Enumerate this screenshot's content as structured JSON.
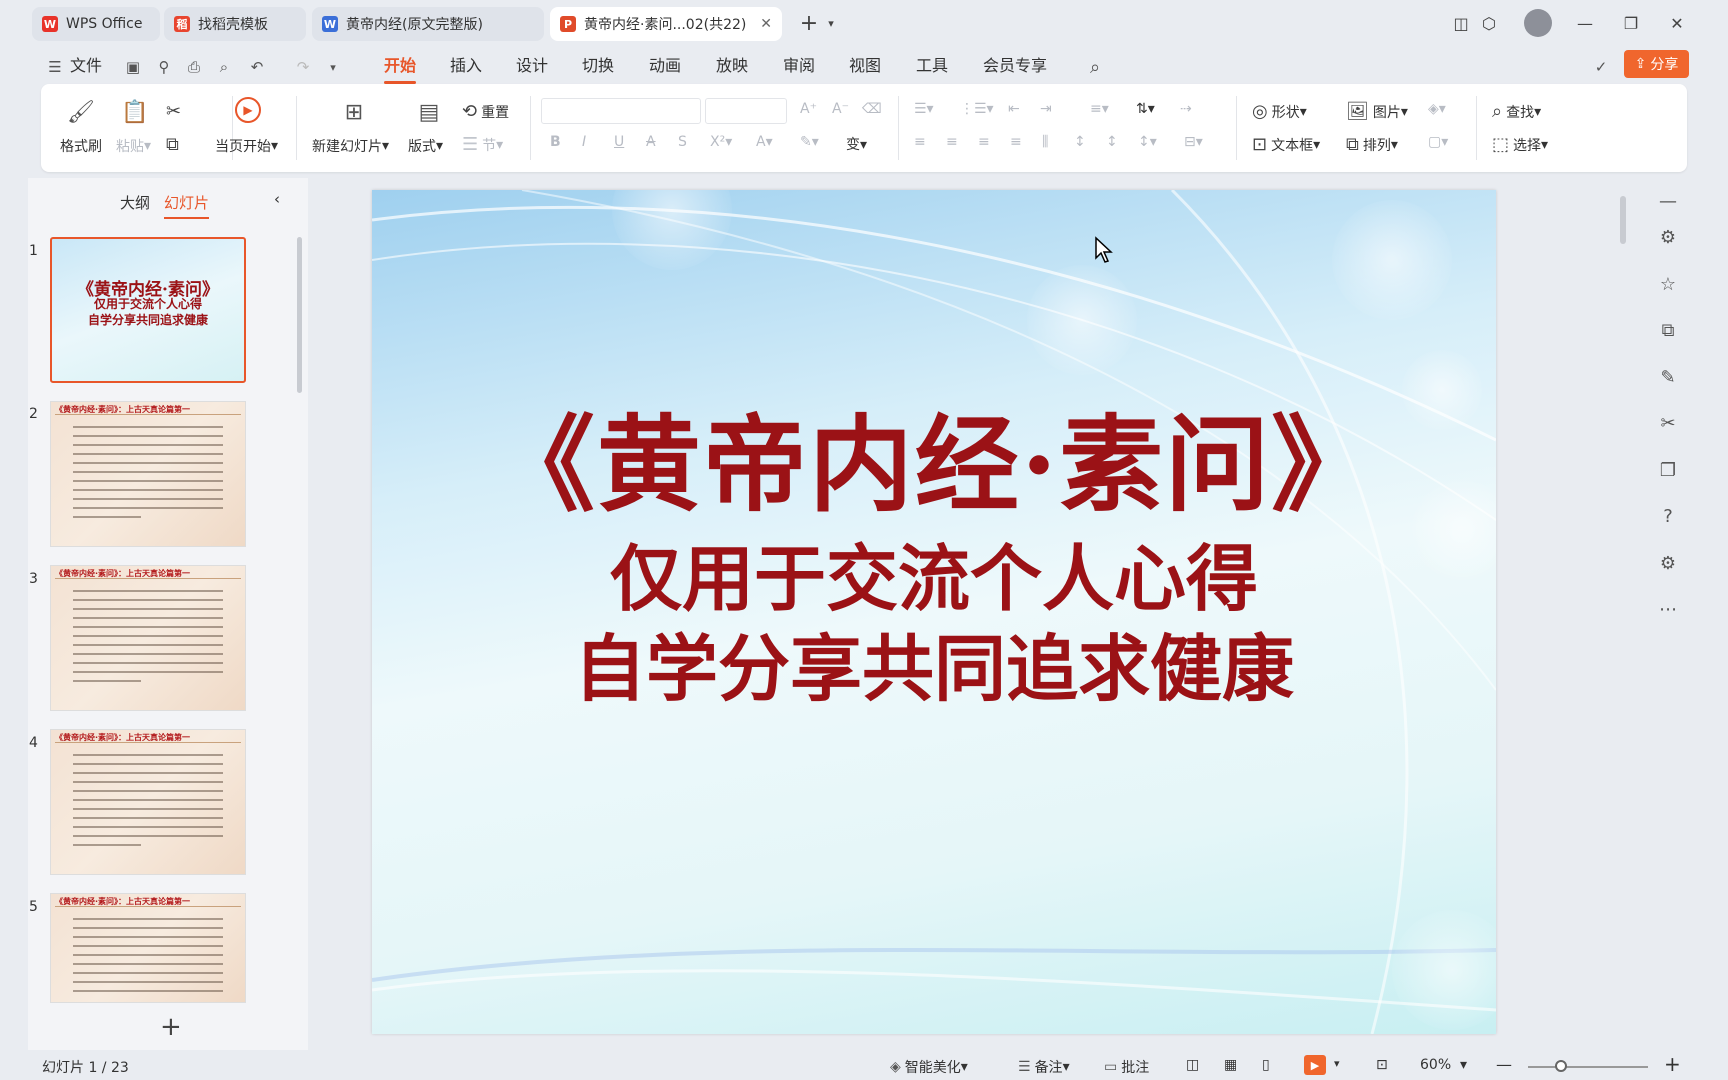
{
  "tabs": [
    {
      "label": "WPS Office",
      "icon": "wps-logo-icon",
      "color": "#e8332a"
    },
    {
      "label": "找稻壳模板",
      "icon": "docer-icon",
      "color": "#e8452f"
    },
    {
      "label": "黄帝内经(原文完整版)",
      "icon": "word-icon",
      "color": "#3b6fd8"
    },
    {
      "label": "黄帝内经·素问...02(共22)",
      "icon": "ppt-icon",
      "color": "#e04b2a"
    }
  ],
  "menu": {
    "file": "文件",
    "items": [
      "开始",
      "插入",
      "设计",
      "切换",
      "动画",
      "放映",
      "审阅",
      "视图",
      "工具",
      "会员专享"
    ],
    "active": "开始",
    "share": "分享"
  },
  "ribbon": {
    "format_painter": "格式刷",
    "paste": "粘贴",
    "from_current": "当页开始",
    "new_slide": "新建幻灯片",
    "layout": "版式",
    "reset": "重置",
    "section": "节",
    "shape": "形状",
    "picture": "图片",
    "find": "查找",
    "textbox": "文本框",
    "arrange": "排列",
    "select": "选择"
  },
  "left_panel": {
    "tab_outline": "大纲",
    "tab_slides": "幻灯片",
    "thumbs": [
      {
        "num": "1",
        "type": "title",
        "t1": "《黄帝内经·素问》",
        "t2": "仅用于交流个人心得",
        "t3": "自学分享共同追求健康"
      },
      {
        "num": "2",
        "type": "text",
        "hdr": "《黄帝内经·素问》：上古天真论篇第一"
      },
      {
        "num": "3",
        "type": "text",
        "hdr": "《黄帝内经·素问》：上古天真论篇第一"
      },
      {
        "num": "4",
        "type": "text",
        "hdr": "《黄帝内经·素问》：上古天真论篇第一"
      },
      {
        "num": "5",
        "type": "text",
        "hdr": "《黄帝内经·素问》：上古天真论篇第一"
      }
    ]
  },
  "slide": {
    "title": "《黄帝内经·素问》",
    "line1": "仅用于交流个人心得",
    "line2": "自学分享共同追求健康",
    "title_color": "#9b1216"
  },
  "status": {
    "slide_info": "幻灯片 1 / 23",
    "smart_beautify": "智能美化",
    "notes": "备注",
    "comments": "批注",
    "zoom": "60%"
  },
  "colors": {
    "accent": "#e8562a",
    "share_bg": "#f0662d"
  }
}
